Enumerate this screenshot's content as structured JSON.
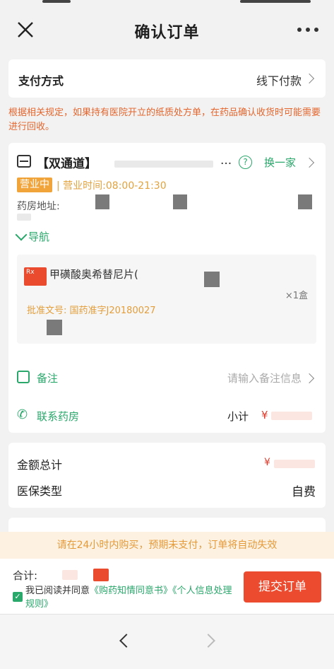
{
  "header": {
    "title": "确认订单"
  },
  "payment": {
    "label": "支付方式",
    "value": "线下付款"
  },
  "notice": "根据相关规定，如果持有医院开立的纸质处方单，在药品确认收货时可能需要进行回收。",
  "store": {
    "name": "【双通道】",
    "ellipsis": "...",
    "switch_label": "换一家",
    "open_badge": "营业中",
    "hours": "| 营业时间:08:00-21:30",
    "address_label": "药房地址:",
    "nav_label": "导航"
  },
  "product": {
    "rx": "Rx",
    "name": "甲磺酸奥希替尼片(",
    "quantity": "×1盒",
    "approval_label": "批准文号:",
    "approval_no": "国药准字J20180027"
  },
  "remark": {
    "label": "备注",
    "placeholder": "请输入备注信息"
  },
  "contact": {
    "label": "联系药房",
    "subtotal_label": "小计",
    "subtotal_value": "¥"
  },
  "summary": {
    "total_label": "金额总计",
    "total_value": "¥",
    "insurance_label": "医保类型",
    "insurance_value": "自费"
  },
  "warning": "请在24小时内购买，预期未支付，订单将自动失效",
  "footer": {
    "total_label": "合计:",
    "total_value": "",
    "agree_text": "我已阅读并同意",
    "link1": "《购药知情同意书》",
    "link2": "《个人信息处理规则》",
    "submit": "提交订单"
  },
  "colors": {
    "accent_green": "#2aa76b",
    "accent_orange": "#e59a3a",
    "primary_red": "#ed4b2f"
  }
}
